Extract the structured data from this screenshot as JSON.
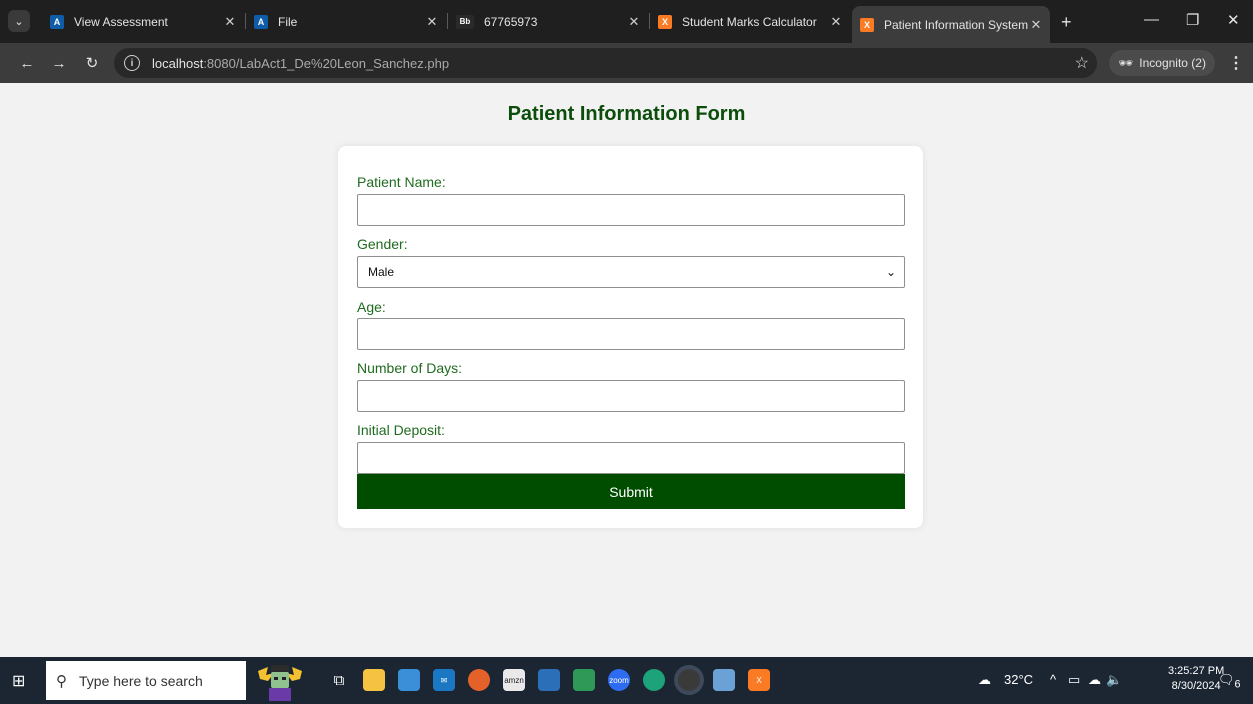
{
  "browser": {
    "tabs": [
      {
        "label": "View Assessment",
        "favicon": "A"
      },
      {
        "label": "File",
        "favicon": "A"
      },
      {
        "label": "67765973",
        "favicon": "Bb"
      },
      {
        "label": "Student Marks Calculator",
        "favicon": "X"
      },
      {
        "label": "Patient Information System",
        "favicon": "X",
        "active": true
      }
    ],
    "url_host": "localhost",
    "url_rest": ":8080/LabAct1_De%20Leon_Sanchez.php",
    "incognito_label": "Incognito (2)"
  },
  "form": {
    "title": "Patient Information Form",
    "patient_name_label": "Patient Name:",
    "gender_label": "Gender:",
    "gender_value": "Male",
    "age_label": "Age:",
    "days_label": "Number of Days:",
    "deposit_label": "Initial Deposit:",
    "submit_label": "Submit"
  },
  "taskbar": {
    "search_placeholder": "Type here to search",
    "weather": "32°C",
    "time": "3:25:27 PM",
    "date": "8/30/2024",
    "notification_count": "6"
  },
  "colors": {
    "title_green": "#0b4d0b",
    "label_green": "#1f6b1f",
    "button_green": "#004d00",
    "page_bg": "#f2f2f2"
  }
}
